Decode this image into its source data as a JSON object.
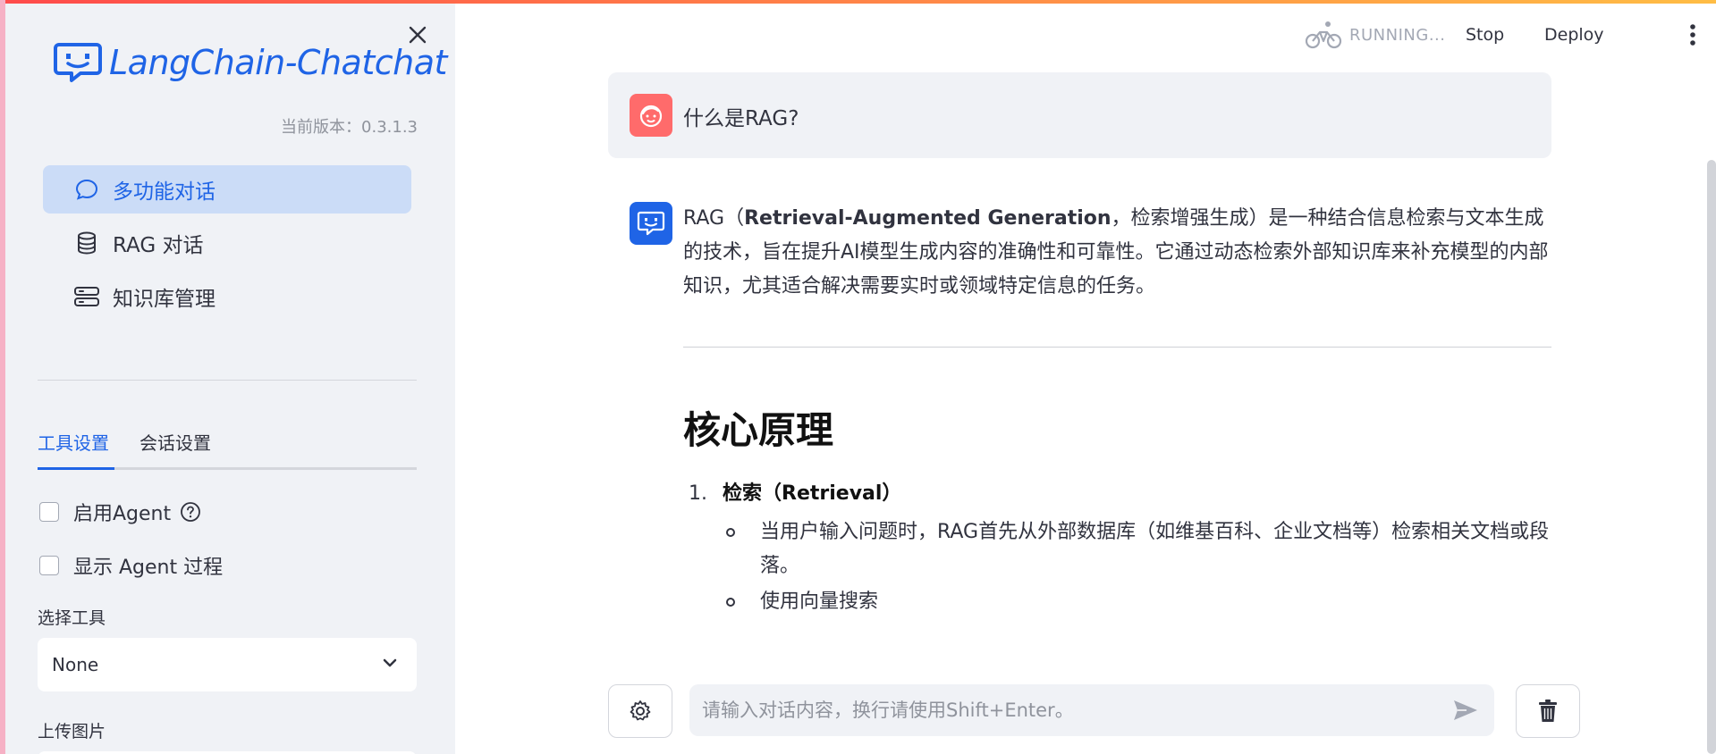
{
  "sidebar": {
    "logo_text": "LangChain-Chatchat",
    "version": "当前版本：0.3.1.3",
    "nav": [
      {
        "label": "多功能对话",
        "icon": "chat-bubble-icon",
        "active": true
      },
      {
        "label": "RAG 对话",
        "icon": "database-icon",
        "active": false
      },
      {
        "label": "知识库管理",
        "icon": "server-icon",
        "active": false
      }
    ],
    "tabs": [
      "工具设置",
      "会话设置"
    ],
    "enable_agent_label": "启用Agent",
    "show_agent_process_label": "显示 Agent 过程",
    "select_tool_label": "选择工具",
    "select_tool_value": "None",
    "upload_image_label": "上传图片"
  },
  "toolbar": {
    "status": "RUNNING...",
    "stop_label": "Stop",
    "deploy_label": "Deploy"
  },
  "chat": {
    "user_message": "什么是RAG?",
    "assistant": {
      "intro_prefix": "RAG（",
      "intro_bold": "Retrieval-Augmented Generation",
      "intro_suffix": "，检索增强生成）是一种结合信息检索与文本生成的技术，旨在提升AI模型生成内容的准确性和可靠性。它通过动态检索外部知识库来补充模型的内部知识，尤其适合解决需要实时或领域特定信息的任务。",
      "heading": "核心原理",
      "item1_number": "1.",
      "item1_title": "检索（Retrieval）",
      "bullet1": "当用户输入问题时，RAG首先从外部数据库（如维基百科、企业文档等）检索相关文档或段落。",
      "bullet2": "使用向量搜索"
    }
  },
  "input": {
    "placeholder": "请输入对话内容，换行请使用Shift+Enter。"
  },
  "colors": {
    "accent": "#1f64e6",
    "sidebar_bg": "#f0f2f6",
    "active_nav_bg": "#cbdcf7",
    "user_avatar": "#ff6b6b"
  }
}
